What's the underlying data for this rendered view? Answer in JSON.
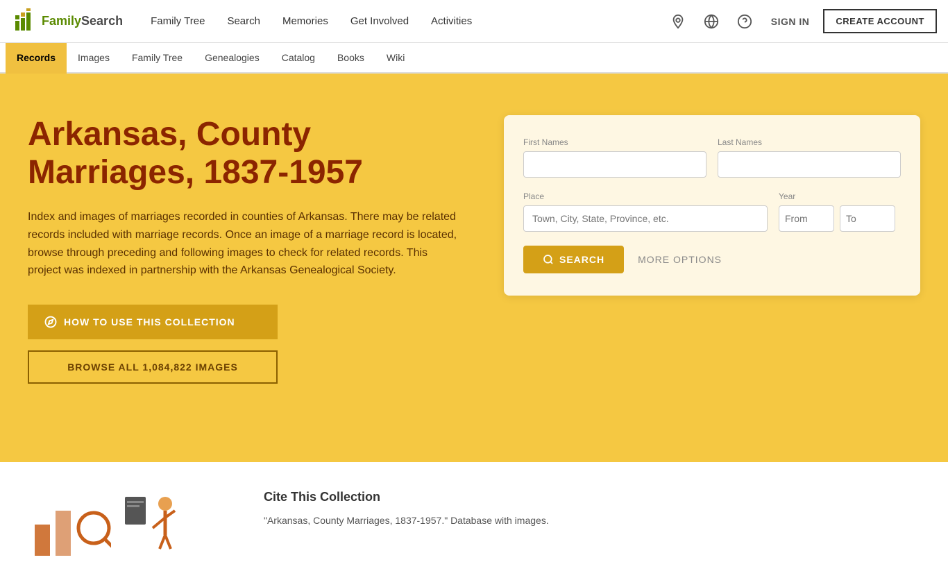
{
  "brand": {
    "logo_text": "FamilySearch",
    "logo_url": "#"
  },
  "top_nav": {
    "items": [
      {
        "label": "Family Tree",
        "id": "family-tree"
      },
      {
        "label": "Search",
        "id": "search"
      },
      {
        "label": "Memories",
        "id": "memories"
      },
      {
        "label": "Get Involved",
        "id": "get-involved"
      },
      {
        "label": "Activities",
        "id": "activities"
      }
    ],
    "sign_in_label": "SIGN IN",
    "create_account_label": "CREATE ACCOUNT"
  },
  "secondary_nav": {
    "items": [
      {
        "label": "Records",
        "id": "records",
        "active": true
      },
      {
        "label": "Images",
        "id": "images"
      },
      {
        "label": "Family Tree",
        "id": "family-tree-2"
      },
      {
        "label": "Genealogies",
        "id": "genealogies"
      },
      {
        "label": "Catalog",
        "id": "catalog"
      },
      {
        "label": "Books",
        "id": "books"
      },
      {
        "label": "Wiki",
        "id": "wiki"
      }
    ]
  },
  "hero": {
    "title": "Arkansas, County Marriages, 1837-1957",
    "description": "Index and images of marriages recorded in counties of Arkansas. There may be related records included with marriage records. Once an image of a marriage record is located, browse through preceding and following images to check for related records. This project was indexed in partnership with the Arkansas Genealogical Society.",
    "how_to_btn": "HOW TO USE THIS COLLECTION",
    "browse_btn": "BROWSE ALL 1,084,822 IMAGES"
  },
  "search_form": {
    "first_names_label": "First Names",
    "last_names_label": "Last Names",
    "place_label": "Place",
    "year_label": "Year",
    "place_placeholder": "Town, City, State, Province, etc.",
    "year_from_placeholder": "From",
    "year_to_placeholder": "To",
    "search_btn_label": "SEARCH",
    "more_options_label": "MORE OPTIONS"
  },
  "bottom": {
    "cite_title": "Cite This Collection",
    "cite_text": "\"Arkansas, County Marriages, 1837-1957.\" Database with images."
  }
}
